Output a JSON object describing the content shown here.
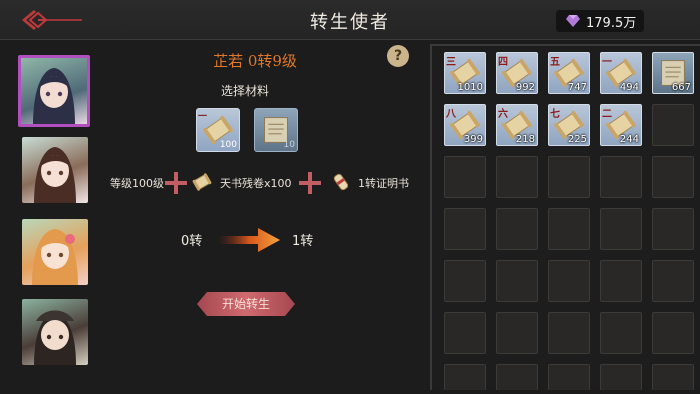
{
  "header": {
    "title": "转生使者",
    "currency_value": "179.5万",
    "colors": {
      "gem": "#b27ad8",
      "back_accent": "#c0393c"
    }
  },
  "portraits": [
    {
      "name": "portrait-1",
      "selected": true
    },
    {
      "name": "portrait-2",
      "selected": false
    },
    {
      "name": "portrait-3",
      "selected": false
    },
    {
      "name": "portrait-4",
      "selected": false
    }
  ],
  "center": {
    "help_label": "?",
    "character_name": "芷若 0转9级",
    "materials_label": "选择材料",
    "material_slots": [
      {
        "tag": "一",
        "count": "100"
      },
      {
        "tag": "",
        "count": "10"
      }
    ],
    "requirement_level": "等级100级",
    "requirement_item": "天书残卷x100",
    "requirement_result": "1转证明书",
    "rebirth_from": "0转",
    "rebirth_to": "1转",
    "start_button": "开始转生"
  },
  "inventory": {
    "items": [
      {
        "tag": "三",
        "count": "1010"
      },
      {
        "tag": "四",
        "count": "992"
      },
      {
        "tag": "五",
        "count": "747"
      },
      {
        "tag": "一",
        "count": "494"
      },
      {
        "tag": "",
        "count": "667"
      },
      {
        "tag": "八",
        "count": "399"
      },
      {
        "tag": "六",
        "count": "218"
      },
      {
        "tag": "七",
        "count": "225"
      },
      {
        "tag": "二",
        "count": "244"
      }
    ]
  }
}
